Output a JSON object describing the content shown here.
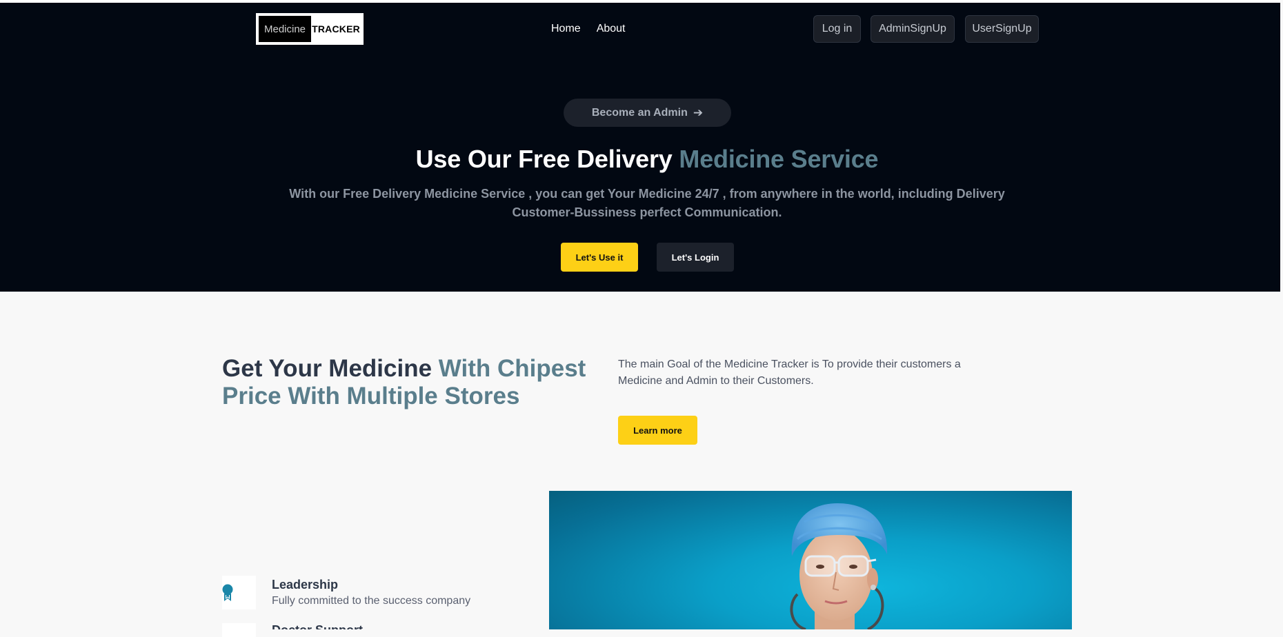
{
  "logo": {
    "left": "Medicine",
    "right": "TRACKER"
  },
  "nav": {
    "home": "Home",
    "about": "About"
  },
  "auth": {
    "login": "Log in",
    "admin_signup": "AdminSignUp",
    "user_signup": "UserSignUp"
  },
  "hero": {
    "pill_label": "Become an Admin",
    "title_main": "Use Our Free Delivery ",
    "title_accent": "Medicine Service",
    "subtitle": "With our Free Delivery Medicine Service , you can get Your Medicine 24/7 , from anywhere in the world, including Delivery Customer-Bussiness perfect Communication.",
    "cta_primary": "Let's Use it",
    "cta_secondary": "Let's Login"
  },
  "section2": {
    "title_main": "Get Your Medicine ",
    "title_accent": "With Chipest Price With Multiple Stores",
    "text": "The main Goal of the Medicine Tracker is To provide their customers a Medicine and Admin to their Customers.",
    "learn_more": "Learn more"
  },
  "features": [
    {
      "title": "Leadership",
      "desc": "Fully committed to the success company"
    },
    {
      "title": "Doctor Support",
      "desc": ""
    }
  ],
  "colors": {
    "accent": "#5a7e8c",
    "yellow": "#fdd016",
    "hero_bg": "#020812"
  }
}
